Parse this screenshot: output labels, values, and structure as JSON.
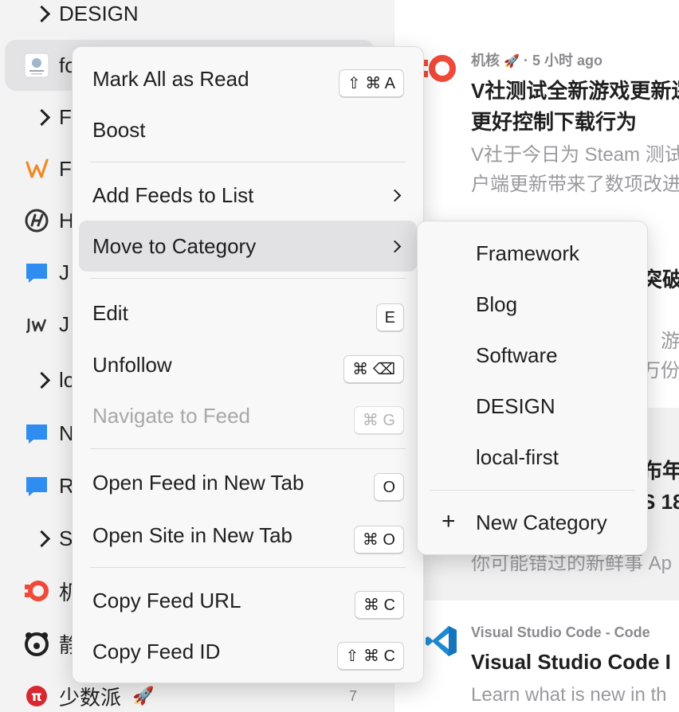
{
  "sidebar": {
    "rows": [
      {
        "label": "DESIGN",
        "count": ""
      },
      {
        "label": "fo",
        "count": ""
      },
      {
        "label": "F",
        "count": ""
      },
      {
        "label": "F",
        "count": ""
      },
      {
        "label": "H",
        "count": ""
      },
      {
        "label": "J",
        "count": ""
      },
      {
        "label": "J",
        "count": ""
      },
      {
        "label": "lo",
        "count": ""
      },
      {
        "label": "N",
        "count": ""
      },
      {
        "label": "R",
        "count": ""
      },
      {
        "label": "S",
        "count": ""
      },
      {
        "label": "机",
        "count": ""
      },
      {
        "label": "静",
        "count": ""
      },
      {
        "label": "少数派",
        "count": "7"
      }
    ],
    "icons": {
      "jhj_glyph": "O",
      "sspai_glyph": "π",
      "rocket": "🚀"
    }
  },
  "context_menu": {
    "items": [
      {
        "label": "Mark All as Read",
        "shortcut": "⇧ ⌘ A"
      },
      {
        "label": "Boost",
        "shortcut": ""
      },
      {
        "label": "Add Feeds to List",
        "shortcut": ""
      },
      {
        "label": "Move to Category",
        "shortcut": ""
      },
      {
        "label": "Edit",
        "shortcut": "E"
      },
      {
        "label": "Unfollow",
        "shortcut": "⌘ ⌫"
      },
      {
        "label": "Navigate to Feed",
        "shortcut": "⌘ G"
      },
      {
        "label": "Open Feed in New Tab",
        "shortcut": "O"
      },
      {
        "label": "Open Site in New Tab",
        "shortcut": "⌘ O"
      },
      {
        "label": "Copy Feed URL",
        "shortcut": "⌘ C"
      },
      {
        "label": "Copy Feed ID",
        "shortcut": "⇧ ⌘ C"
      }
    ]
  },
  "category_submenu": {
    "items": [
      "Framework",
      "Blog",
      "Software",
      "DESIGN",
      "local-first"
    ],
    "new_category": "New Category",
    "plus_glyph": "+"
  },
  "articles": [
    {
      "source": "机核",
      "time": "· 5 小时 ago",
      "title_lines": [
        "V社测试全新游戏更新逻",
        "更好控制下载行为"
      ],
      "summary_lines": [
        "V社于今日为 Steam 测试",
        "户端更新带来了数项改进"
      ]
    },
    {
      "title_lines": [
        "突破"
      ],
      "summary_lines": [
        "，游",
        "万份"
      ]
    },
    {
      "title_lines": [
        "布年",
        "S 18"
      ],
      "summary_lines": [
        "你可能错过的新鲜事 Ap"
      ]
    },
    {
      "source": "Visual Studio Code - Code",
      "title_lines": [
        "Visual Studio Code I"
      ],
      "summary_lines": [
        "Learn what is new in th"
      ]
    }
  ],
  "colors": {
    "jhj_red": "#ef4a39",
    "sspai_red": "#d7282f",
    "vscode_blue": "#1f8ad2",
    "chat_blue": "#2f8cf0",
    "wp_orange": "#f08a24"
  }
}
